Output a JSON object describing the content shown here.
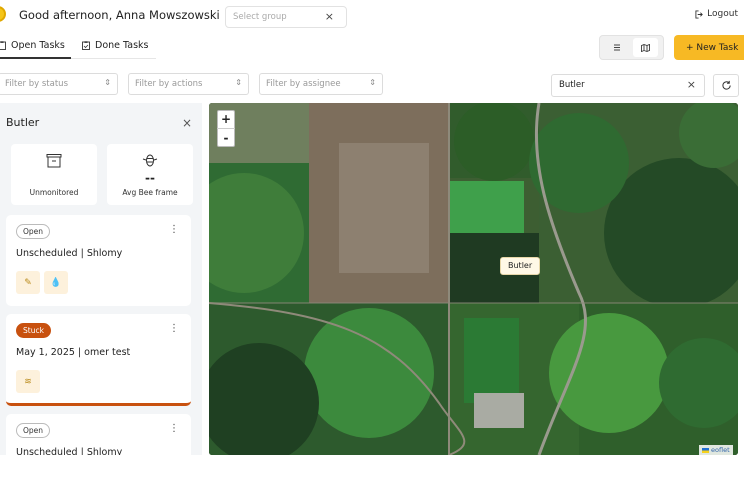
{
  "header": {
    "greeting": "Good afternoon, Anna Mowszowski",
    "group_placeholder": "Select group",
    "clear_icon": "×",
    "logout_label": "Logout"
  },
  "tabs": [
    {
      "label": "Open Tasks",
      "active": true
    },
    {
      "label": "Done Tasks",
      "active": false
    }
  ],
  "toolbar": {
    "list_view_icon": "list-icon",
    "map_view_icon": "map-icon",
    "active_view": "map",
    "new_task_label": "+ New Task"
  },
  "filters": {
    "status_placeholder": "Filter by status",
    "actions_placeholder": "Filter by actions",
    "assignee_placeholder": "Filter by assignee",
    "search_value": "Butler"
  },
  "panel": {
    "title": "Butler",
    "stats": [
      {
        "icon": "hive-box-icon",
        "value": "",
        "label": "Unmonitored"
      },
      {
        "icon": "bee-frame-icon",
        "value": "--",
        "label": "Avg Bee frame"
      }
    ],
    "cards": [
      {
        "status": "Open",
        "title": "Unscheduled | Shlomy",
        "actions": [
          "edit-icon",
          "drop-icon"
        ]
      },
      {
        "status": "Stuck",
        "title": "May 1, 2025 | omer test",
        "actions": [
          "feed-icon"
        ]
      },
      {
        "status": "Open",
        "title": "Unscheduled | Shlomy",
        "actions": []
      }
    ]
  },
  "map": {
    "zoom_in": "+",
    "zoom_out": "-",
    "marker_label": "Butler",
    "attribution": "eoflet"
  },
  "colors": {
    "accent": "#f7b924",
    "stuck": "#c8510f",
    "panel_bg": "#f3f5f7"
  }
}
